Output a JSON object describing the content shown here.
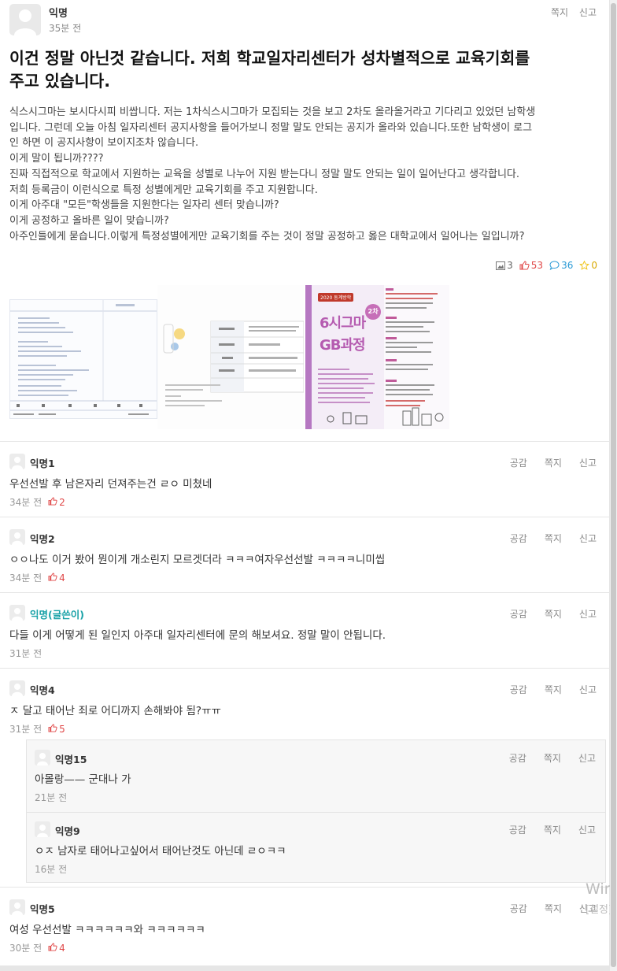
{
  "article": {
    "author": "익명",
    "time": "35분 전",
    "actions": {
      "message": "쪽지",
      "report": "신고"
    },
    "title_line1": "이건 정말 아닌것 같습니다. 저희 학교일자리센터가 성차별적으로 교육기회를",
    "title_line2": "주고 있습니다.",
    "body_lines": [
      "식스시그마는 보시다시피 비쌉니다. 저는 1차식스시그마가 모집되는 것을 보고 2차도 올라올거라고 기다리고 있었던 남학생",
      "입니다. 그런데 오늘 아침 일자리센터 공지사항을 들어가보니 정말 말도 안되는 공지가 올라와 있습니다.또한 남학생이 로그",
      "인 하면 이 공지사항이 보이지조차 않습니다.",
      "이게 말이 됩니까????",
      "진짜 직접적으로 학교에서 지원하는 교육을 성별로 나누어 지원 받는다니 정말 말도 안되는 일이 일어난다고 생각합니다.",
      "저희 등록금이 이런식으로 특정 성별에게만 교육기회를 주고 지원합니다.",
      "이게 아주대 \"모든\"학생들을 지원한다는 일자리 센터 맞습니까?",
      "이게 공정하고 올바른 일이 맞습니까?",
      "아주인들에게 묻습니다.이렇게 특정성별에게만 교육기회를 주는 것이 정말 공정하고 옳은 대학교에서 일어나는 일입니까?"
    ],
    "stats": {
      "images": "3",
      "likes": "53",
      "comments": "36",
      "scraps": "0"
    },
    "colors": {
      "likes": "#e04848",
      "comments": "#2a9ad6",
      "scraps": "#f0c419"
    },
    "poster": {
      "badge": "2차",
      "line1": "6시그마",
      "line2": "GB과정",
      "tag": "2020 동계방학"
    }
  },
  "comments": [
    {
      "author": "익명1",
      "text": "우선선발 후 남은자리 던져주는건 ㄹㅇ 미쳤네",
      "time": "34분 전",
      "likes": "2",
      "is_op": false
    },
    {
      "author": "익명2",
      "text": "ㅇㅇ나도 이거 봤어 뭔이게 개소린지 모르겟더라 ㅋㅋㅋ여자우선선발 ㅋㅋㅋㅋ니미씹",
      "time": "34분 전",
      "likes": "4",
      "is_op": false
    },
    {
      "author": "익명(글쓴이)",
      "text": "다들 이게 어떻게 된 일인지 아주대 일자리센터에 문의 해보셔요. 정말 말이 안됩니다.",
      "time": "31분 전",
      "likes": "",
      "is_op": true
    },
    {
      "author": "익명4",
      "text": "ㅈ 달고 태어난 죄로 어디까지 손해봐야 됨?ㅠㅠ",
      "time": "31분 전",
      "likes": "5",
      "is_op": false
    },
    {
      "author": "익명5",
      "text": "여성 우선선발 ㅋㅋㅋㅋㅋㅋ와 ㅋㅋㅋㅋㅋㅋ",
      "time": "30분 전",
      "likes": "4",
      "is_op": false
    }
  ],
  "replies": [
    {
      "author": "익명15",
      "text": "아몰랑—— 군대나 가",
      "time": "21분 전"
    },
    {
      "author": "익명9",
      "text": "ㅇㅈ 남자로 태어나고싶어서 태어난것도 아닌데 ㄹㅇㅋㅋ",
      "time": "16분 전"
    }
  ],
  "comment_actions": {
    "like": "공감",
    "message": "쪽지",
    "report": "신고"
  },
  "watermark": {
    "line1": "Wind",
    "line2": "[설정]"
  }
}
